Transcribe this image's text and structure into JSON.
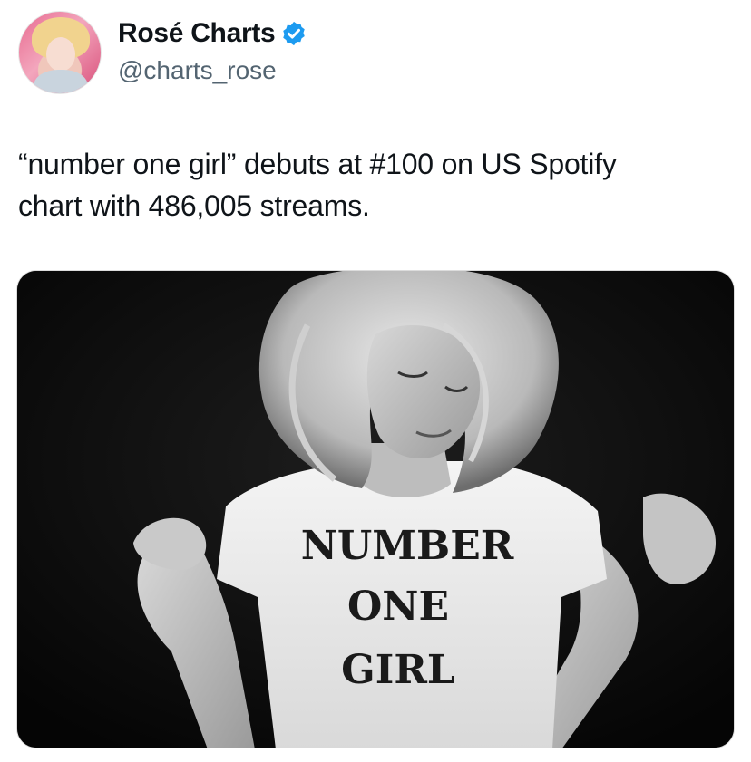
{
  "author": {
    "display_name": "Rosé Charts",
    "handle": "@charts_rose",
    "verified": true,
    "verified_icon": "verified-badge-icon",
    "badge_color": "#1d9bf0"
  },
  "tweet": {
    "text_line1": "“number one girl” debuts at #100 on US Spotify",
    "text_line2": "chart with 486,005 streams."
  },
  "media": {
    "shirt_line1": "NUMBER",
    "shirt_line2": "ONE",
    "shirt_line3": "GIRL"
  },
  "colors": {
    "text": "#0f1419",
    "secondary_text": "#536471",
    "background": "#ffffff"
  }
}
